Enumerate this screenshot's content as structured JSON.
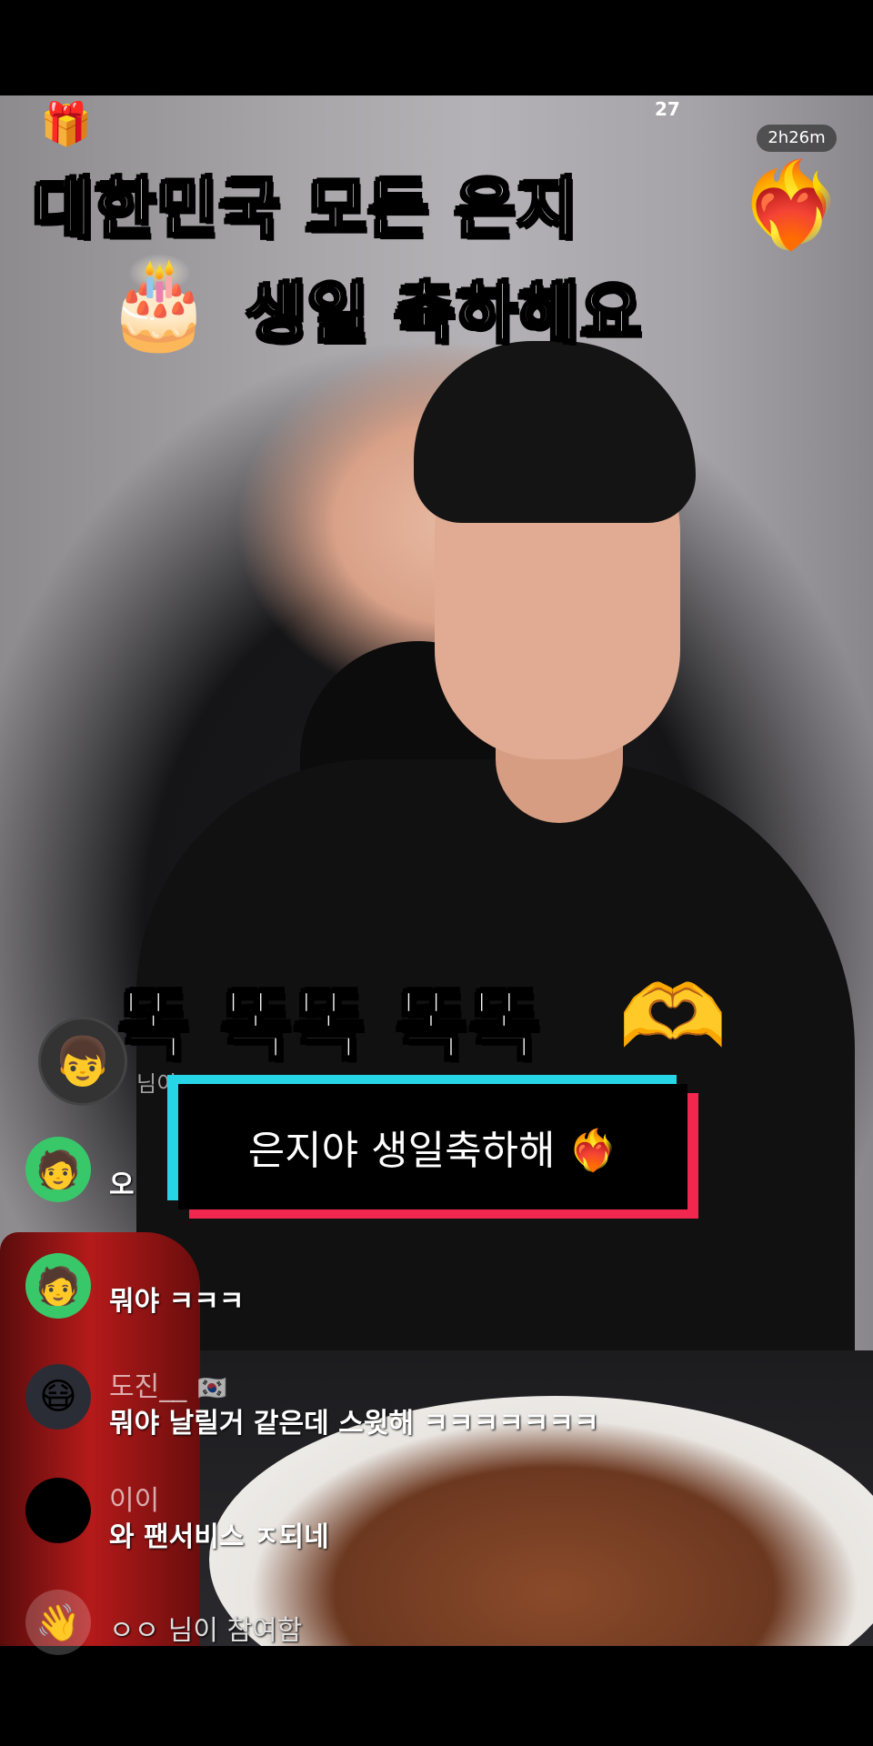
{
  "stream": {
    "gift_icon": "treasure-chest-icon",
    "top_counter": "27",
    "timer": "2h26m"
  },
  "captions": {
    "line1": "대한민국 모든 은지",
    "line1_emoji": "❤️‍🔥",
    "line2": "생일 축하해요",
    "line2_emoji": "🎂",
    "line3": "똑 똑똑 똑똑",
    "line3_emoji": "🫶"
  },
  "sticker": {
    "text": "은지야 생일축하해 ❤️‍🔥",
    "colors": {
      "cyan": "#27d6e6",
      "red": "#f2274f",
      "box": "#000000"
    }
  },
  "guest": {
    "avatar_icon": "👦",
    "text": "님이 ..."
  },
  "comments": [
    {
      "user": "",
      "avatar": "🧑",
      "message": "오"
    },
    {
      "user": "",
      "avatar": "🧑",
      "message": "뭐야 ㅋㅋㅋ"
    },
    {
      "user": "도진__",
      "flag": "🇰🇷",
      "avatar": "😷",
      "message": "뭐야 날릴거 같은데 스윗해 ㅋㅋㅋㅋㅋㅋㅋ"
    },
    {
      "user": "이이",
      "avatar": "",
      "message": "와 팬서비스 ㅈ되네"
    },
    {
      "user": "",
      "avatar": "👋",
      "message": "ㅇㅇ 님이 참여함"
    }
  ]
}
